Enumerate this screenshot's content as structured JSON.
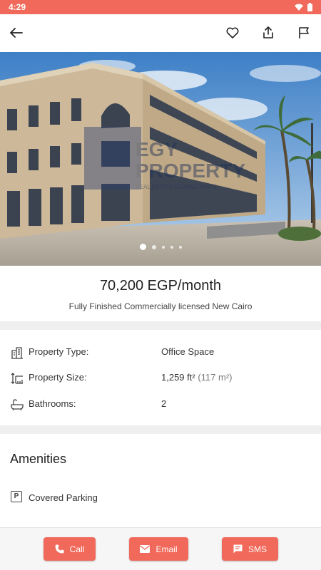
{
  "status_bar": {
    "time": "4:29"
  },
  "listing": {
    "price": "70,200 EGP/month",
    "subtitle": "Fully Finished Commercially licensed New Cairo",
    "image_count": 5,
    "active_image_index": 0,
    "watermark": {
      "line1": "EGY",
      "line2": "PROPERTY",
      "line3": "REAL ESTATE CONSULTANTS"
    }
  },
  "details": [
    {
      "icon": "building-icon",
      "label": "Property Type:",
      "value": "Office Space",
      "sub": ""
    },
    {
      "icon": "ruler-icon",
      "label": "Property Size:",
      "value": "1,259 ft²",
      "sub": "(117 m²)"
    },
    {
      "icon": "bathtub-icon",
      "label": "Bathrooms:",
      "value": "2",
      "sub": ""
    }
  ],
  "amenities": {
    "title": "Amenities",
    "items": [
      {
        "icon": "parking-icon",
        "glyph": "P",
        "label": "Covered Parking"
      }
    ]
  },
  "actions": {
    "call": "Call",
    "email": "Email",
    "sms": "SMS"
  },
  "colors": {
    "accent": "#f0695a",
    "background": "#ffffff",
    "divider": "#efefef"
  }
}
